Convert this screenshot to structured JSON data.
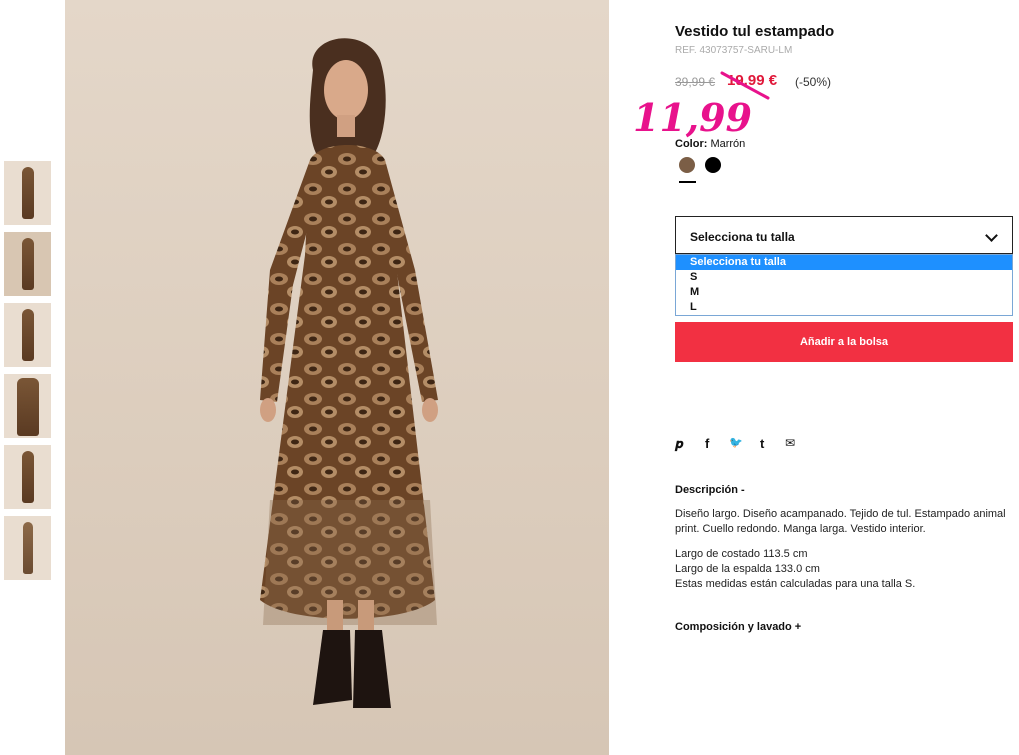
{
  "product": {
    "title": "Vestido tul estampado",
    "ref": "REF. 43073757-SARU-LM",
    "price_old": "39,99 €",
    "price_sale": "19,99 €",
    "discount": "(-50%)",
    "handwritten_price": "11,99",
    "color_label": "Color:",
    "color_value": "Marrón",
    "colors": [
      {
        "name": "Marrón",
        "hex": "#7b5e46"
      },
      {
        "name": "Negro",
        "hex": "#000000"
      }
    ]
  },
  "size_select": {
    "value": "Selecciona tu talla",
    "options": [
      "Selecciona tu talla",
      "S",
      "M",
      "L"
    ]
  },
  "add_to_bag": "Añadir a la bolsa",
  "social": {
    "pinterest": "𝒑",
    "facebook": "f",
    "twitter": "🐦",
    "tumblr": "t",
    "email": "✉"
  },
  "description": {
    "heading": "Descripción -",
    "text": "Diseño largo. Diseño acampanado. Tejido de tul. Estampado animal print. Cuello redondo. Manga larga. Vestido interior.",
    "measure_1": "Largo de costado 113.5 cm",
    "measure_2": "Largo de la espalda 133.0 cm",
    "measure_3": "Estas medidas están calculadas para una talla S."
  },
  "composition_heading": "Composición y lavado +",
  "colors": {
    "sale_red": "#e0183a",
    "button_red": "#f23042",
    "highlight_blue": "#1e90ff",
    "handwritten_pink": "#e8128c"
  }
}
